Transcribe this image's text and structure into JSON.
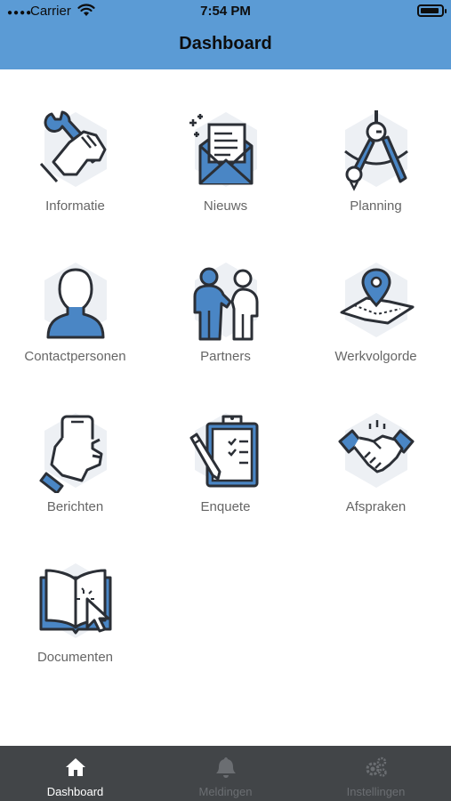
{
  "status_bar": {
    "carrier": "Carrier",
    "time": "7:54 PM",
    "battery_level": 0.9
  },
  "nav": {
    "title": "Dashboard"
  },
  "tiles": [
    {
      "label": "Informatie",
      "icon": "wrench-hand-icon"
    },
    {
      "label": "Nieuws",
      "icon": "newsletter-envelope-icon"
    },
    {
      "label": "Planning",
      "icon": "drafting-compass-icon"
    },
    {
      "label": "Contactpersonen",
      "icon": "person-silhouette-icon"
    },
    {
      "label": "Partners",
      "icon": "partners-people-icon"
    },
    {
      "label": "Werkvolgorde",
      "icon": "map-pin-icon"
    },
    {
      "label": "Berichten",
      "icon": "phone-in-hand-icon"
    },
    {
      "label": "Enquete",
      "icon": "clipboard-checklist-icon"
    },
    {
      "label": "Afspraken",
      "icon": "handshake-icon"
    },
    {
      "label": "Documenten",
      "icon": "open-book-cursor-icon"
    }
  ],
  "tabbar": {
    "tabs": [
      {
        "label": "Dashboard",
        "icon": "home-icon",
        "active": true
      },
      {
        "label": "Meldingen",
        "icon": "bell-icon",
        "active": false
      },
      {
        "label": "Instellingen",
        "icon": "gears-icon",
        "active": false
      }
    ]
  },
  "colors": {
    "nav_bar": "#5b9bd5",
    "icon_blue": "#4a86c5",
    "icon_stroke": "#2b2f36",
    "icon_bg_hex": "#edf0f4",
    "tab_bar": "#424548",
    "label_gray": "#666666"
  }
}
